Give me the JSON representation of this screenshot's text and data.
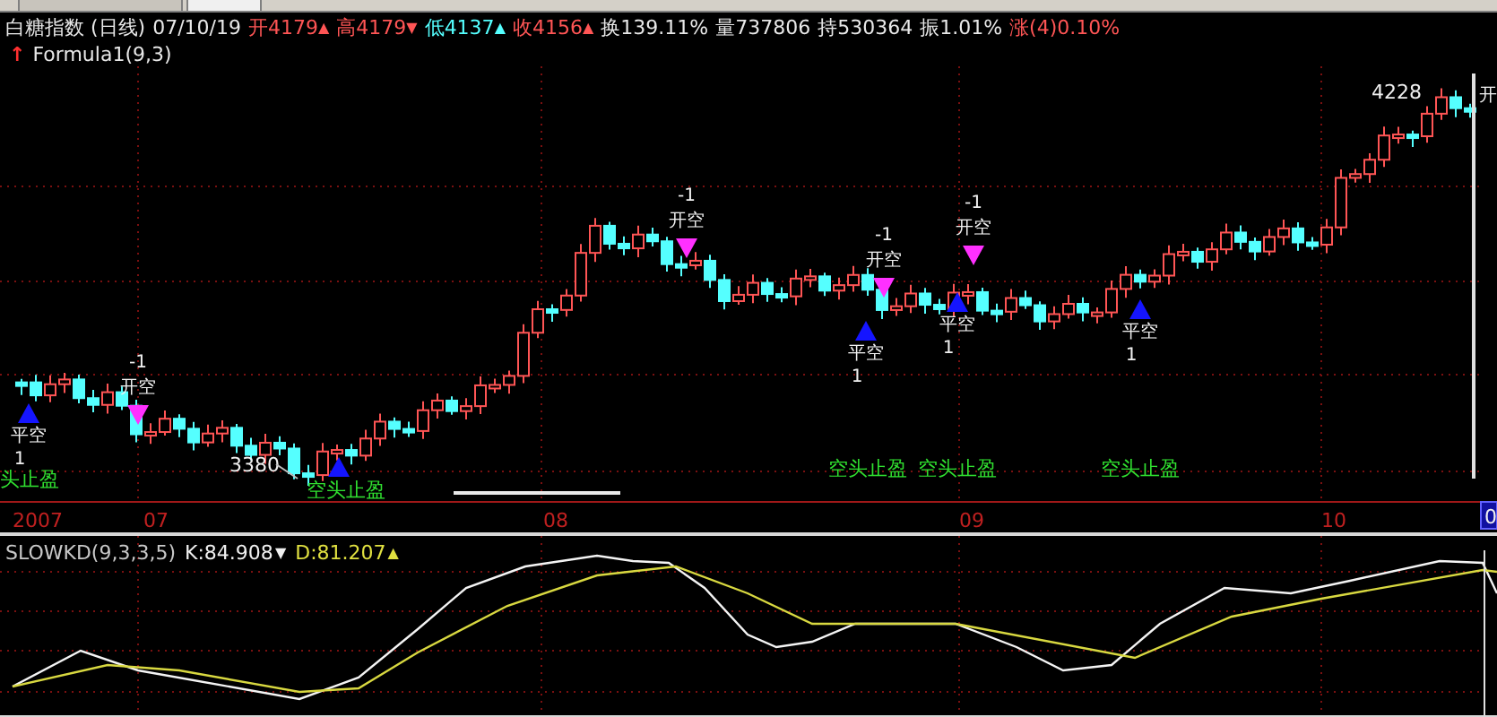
{
  "header": {
    "title": "白糖指数 (日线)",
    "date": "07/10/19",
    "fields": [
      {
        "label": "开",
        "value": "4179",
        "color": "#ff5555",
        "arrow": "▲"
      },
      {
        "label": "高",
        "value": "4179",
        "color": "#ff5555",
        "arrow": "▼"
      },
      {
        "label": "低",
        "value": "4137",
        "color": "#55ffff",
        "arrow": "▲"
      },
      {
        "label": "收",
        "value": "4156",
        "color": "#ff5555",
        "arrow": "▲"
      },
      {
        "label": "换",
        "value": "139.11%",
        "color": "#e8e8e8"
      },
      {
        "label": "量",
        "value": "737806",
        "color": "#e8e8e8"
      },
      {
        "label": "持",
        "value": "530364",
        "color": "#e8e8e8"
      },
      {
        "label": "振",
        "value": "1.01%",
        "color": "#e8e8e8"
      },
      {
        "label": "涨",
        "value": "(4)0.10%",
        "color": "#ff5555"
      }
    ]
  },
  "formula": {
    "name": "Formula1(9,3)",
    "arrow": "↑"
  },
  "chart": {
    "signals": [
      {
        "kind": "close-short",
        "label": "平空",
        "count": "1"
      },
      {
        "kind": "open-short",
        "label": "开空",
        "count": "-1"
      },
      {
        "kind": "close-short"
      },
      {
        "kind": "open-short",
        "label": "开空",
        "count": "-1"
      },
      {
        "kind": "open-short",
        "label": "开空",
        "count": "-1"
      },
      {
        "kind": "close-short",
        "label": "平空",
        "count": "1"
      },
      {
        "kind": "open-short",
        "label": "开空",
        "count": "-1"
      },
      {
        "kind": "close-short",
        "label": "平空",
        "count": "1"
      },
      {
        "kind": "close-short",
        "label": "平空",
        "count": "1"
      }
    ],
    "stop_labels": [
      "头止盈",
      "空头止盈",
      "空头止盈",
      "空头止盈",
      "空头止盈"
    ],
    "price_marks": [
      "3380",
      "4228"
    ],
    "edge_label": "开",
    "x_labels": [
      "2007",
      "07",
      "08",
      "09",
      "10"
    ],
    "cursor_value": "0"
  },
  "indicator": {
    "name": "SLOWKD(9,3,3,5)",
    "values": [
      {
        "label": "K:84.908",
        "color": "#f0f0f0",
        "arrow": "▼"
      },
      {
        "label": "D:81.207",
        "color": "#e0e040",
        "arrow": "▲"
      }
    ]
  }
}
